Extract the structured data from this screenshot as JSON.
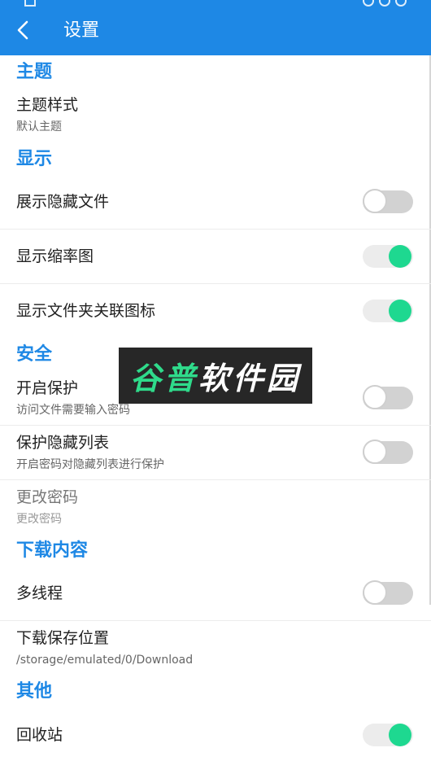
{
  "header": {
    "title": "设置"
  },
  "sections": {
    "theme": {
      "label": "主题",
      "items": {
        "style": {
          "title": "主题样式",
          "subtitle": "默认主题"
        }
      }
    },
    "display": {
      "label": "显示",
      "items": {
        "show_hidden": {
          "title": "展示隐藏文件",
          "enabled": false
        },
        "thumbnails": {
          "title": "显示缩率图",
          "enabled": true
        },
        "folder_icons": {
          "title": "显示文件夹关联图标",
          "enabled": true
        }
      }
    },
    "security": {
      "label": "安全",
      "items": {
        "protection": {
          "title": "开启保护",
          "subtitle": "访问文件需要输入密码",
          "enabled": false
        },
        "hidden_list": {
          "title": "保护隐藏列表",
          "subtitle": "开启密码对隐藏列表进行保护",
          "enabled": false
        },
        "change_password": {
          "title": "更改密码",
          "subtitle": "更改密码"
        }
      }
    },
    "download": {
      "label": "下载内容",
      "items": {
        "multithread": {
          "title": "多线程",
          "enabled": false
        },
        "save_location": {
          "title": "下载保存位置",
          "subtitle": "/storage/emulated/0/Download"
        }
      }
    },
    "other": {
      "label": "其他",
      "items": {
        "recycle_bin": {
          "title": "回收站",
          "enabled": true
        }
      }
    }
  },
  "watermark": {
    "part1": "谷普",
    "part2": "软件园"
  },
  "colors": {
    "accent": "#1e88e5",
    "switch_on": "#1ed890"
  }
}
